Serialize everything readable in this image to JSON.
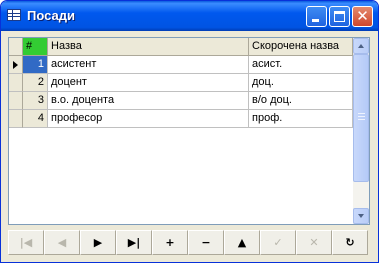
{
  "window": {
    "title": "Посади",
    "title_icon": "table-icon",
    "controls": {
      "minimize": "minimize-icon",
      "maximize": "maximize-icon",
      "close": "close-icon"
    }
  },
  "grid": {
    "columns": [
      {
        "key": "num",
        "label": "#"
      },
      {
        "key": "name",
        "label": "Назва"
      },
      {
        "key": "short",
        "label": "Скорочена назва"
      }
    ],
    "rows": [
      {
        "num": "1",
        "name": "асистент",
        "short": "асист.",
        "current": true
      },
      {
        "num": "2",
        "name": "доцент",
        "short": "доц.",
        "current": false
      },
      {
        "num": "3",
        "name": "в.о. доцента",
        "short": "в/о доц.",
        "current": false
      },
      {
        "num": "4",
        "name": "професор",
        "short": "проф.",
        "current": false
      }
    ],
    "indicator_icon": "row-pointer-icon",
    "selected_color": "#316ac5",
    "key_header_color": "#33cc33"
  },
  "navigator": {
    "buttons": [
      {
        "name": "first",
        "icon": "first-record-icon",
        "glyph": "|◀",
        "enabled": false
      },
      {
        "name": "prior",
        "icon": "prior-record-icon",
        "glyph": "◀",
        "enabled": false
      },
      {
        "name": "next",
        "icon": "next-record-icon",
        "glyph": "▶",
        "enabled": true
      },
      {
        "name": "last",
        "icon": "last-record-icon",
        "glyph": "▶|",
        "enabled": true
      },
      {
        "name": "insert",
        "icon": "plus-icon",
        "glyph": "+",
        "enabled": true
      },
      {
        "name": "delete",
        "icon": "minus-icon",
        "glyph": "−",
        "enabled": true
      },
      {
        "name": "edit",
        "icon": "edit-icon",
        "glyph": "▲",
        "enabled": true
      },
      {
        "name": "post",
        "icon": "check-icon",
        "glyph": "✓",
        "enabled": false
      },
      {
        "name": "cancel",
        "icon": "cancel-icon",
        "glyph": "✕",
        "enabled": false
      },
      {
        "name": "refresh",
        "icon": "refresh-icon",
        "glyph": "↻",
        "enabled": true
      }
    ]
  }
}
